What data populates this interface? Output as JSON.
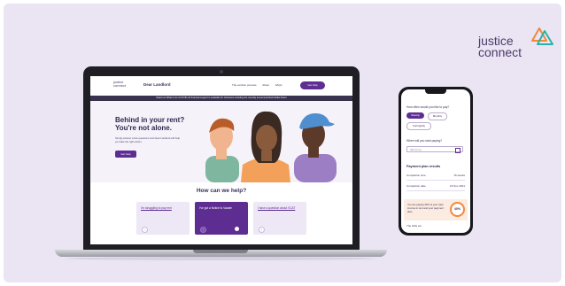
{
  "brand": {
    "line1": "justice",
    "line2": "connect"
  },
  "site": {
    "logo_line1": "justice",
    "logo_line2": "connect",
    "title": "Dear Landlord",
    "nav": [
      "The eviction process",
      "About",
      "FAQs"
    ],
    "nav_button": "Get help",
    "banner": "Read our What to do if COVID-19 financial support is available for Victorians including the recently announced Rent Relief Grant",
    "hero_title_1": "Behind in your rent?",
    "hero_title_2": "You're not alone.",
    "hero_desc": "Simply answer a few questions and Dear Landlord will help you take the right action.",
    "hero_button": "Get help",
    "help_title": "How can we help?",
    "cards": [
      {
        "label": "I'm struggling to pay rent",
        "active": false
      },
      {
        "label": "I've got a Notice to Vacate",
        "active": true
      },
      {
        "label": "I have a question about VCAT",
        "active": false
      }
    ]
  },
  "phone": {
    "q1": "How often would you like to pay?",
    "options": [
      "Weekly",
      "Monthly",
      "Fortnightly"
    ],
    "q2": "When will you start paying?",
    "date_placeholder": "dd/mm/yy",
    "results_title": "Payment plan results",
    "rows": [
      {
        "label": "Completion time",
        "value": "15 weeks"
      },
      {
        "label": "Completion date",
        "value": "16 Nov 2021"
      }
    ],
    "warning": "You are paying 40% of your total income in rent and your payment plan.",
    "gauge": "40%",
    "footer": "The Gifts we"
  },
  "colors": {
    "accent": "#5e2d91",
    "background": "#eae4f3",
    "warning": "#f08a3c"
  }
}
